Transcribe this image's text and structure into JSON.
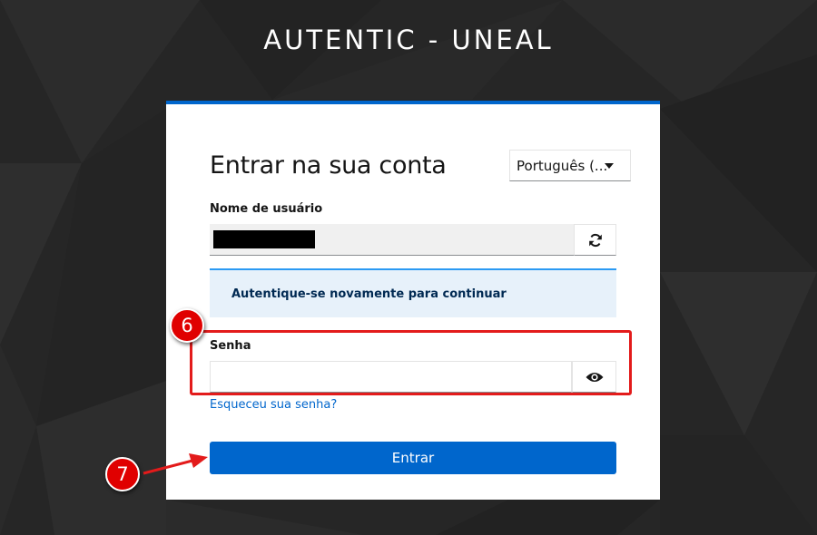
{
  "app": {
    "title": "AUTENTIC - UNEAL"
  },
  "login": {
    "heading": "Entrar na sua conta",
    "language_select": {
      "selected": "Português (..."
    },
    "username": {
      "label": "Nome de usuário"
    },
    "alert": {
      "message": "Autentique-se novamente para continuar"
    },
    "password": {
      "label": "Senha",
      "value": ""
    },
    "forgot_password": "Esqueceu sua senha?",
    "submit_label": "Entrar"
  },
  "annotations": {
    "step_6": "6",
    "step_7": "7",
    "color": "#e31b1b"
  },
  "icons": {
    "reset": "refresh-icon",
    "show_password": "eye-icon",
    "dropdown": "caret-down-icon"
  },
  "colors": {
    "primary": "#0066cc",
    "alert_bg": "#e7f1fa",
    "alert_border": "#2b9af3",
    "background": "#262626"
  }
}
